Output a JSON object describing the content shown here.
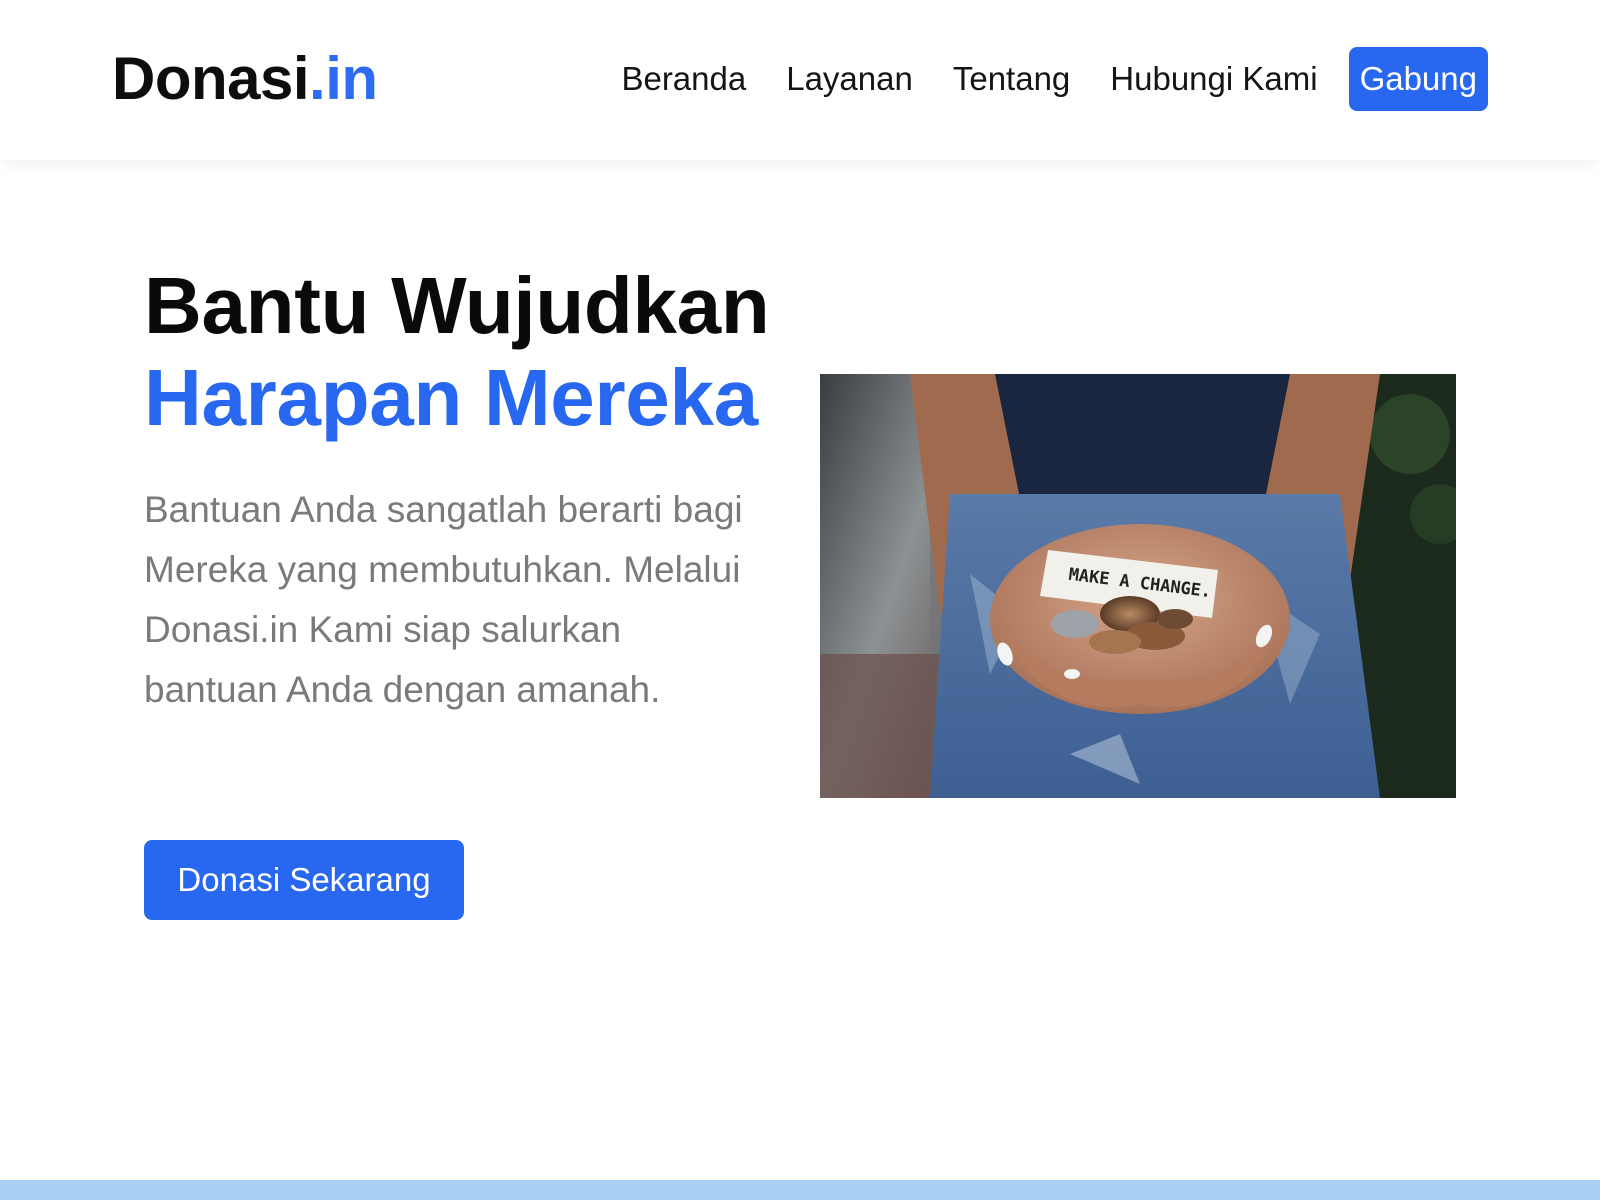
{
  "brand": {
    "name": "Donasi",
    "suffix": ".in"
  },
  "nav": {
    "items": [
      {
        "label": "Beranda"
      },
      {
        "label": "Layanan"
      },
      {
        "label": "Tentang"
      },
      {
        "label": "Hubungi Kami"
      }
    ],
    "cta_label": "Gabung"
  },
  "hero": {
    "title_line1": "Bantu Wujudkan",
    "title_line2": "Harapan Mereka",
    "description": "Bantuan Anda sangatlah berarti bagi Mereka yang membutuhkan. Melalui Donasi.in Kami siap salurkan bantuan Anda dengan amanah.",
    "button_label": "Donasi Sekarang",
    "image_note_text": "MAKE A CHANGE."
  },
  "colors": {
    "accent": "#2868f0",
    "text_dark": "#0a0a0a",
    "text_muted": "#7a7a7a",
    "footer_band": "#a7d0f2"
  }
}
